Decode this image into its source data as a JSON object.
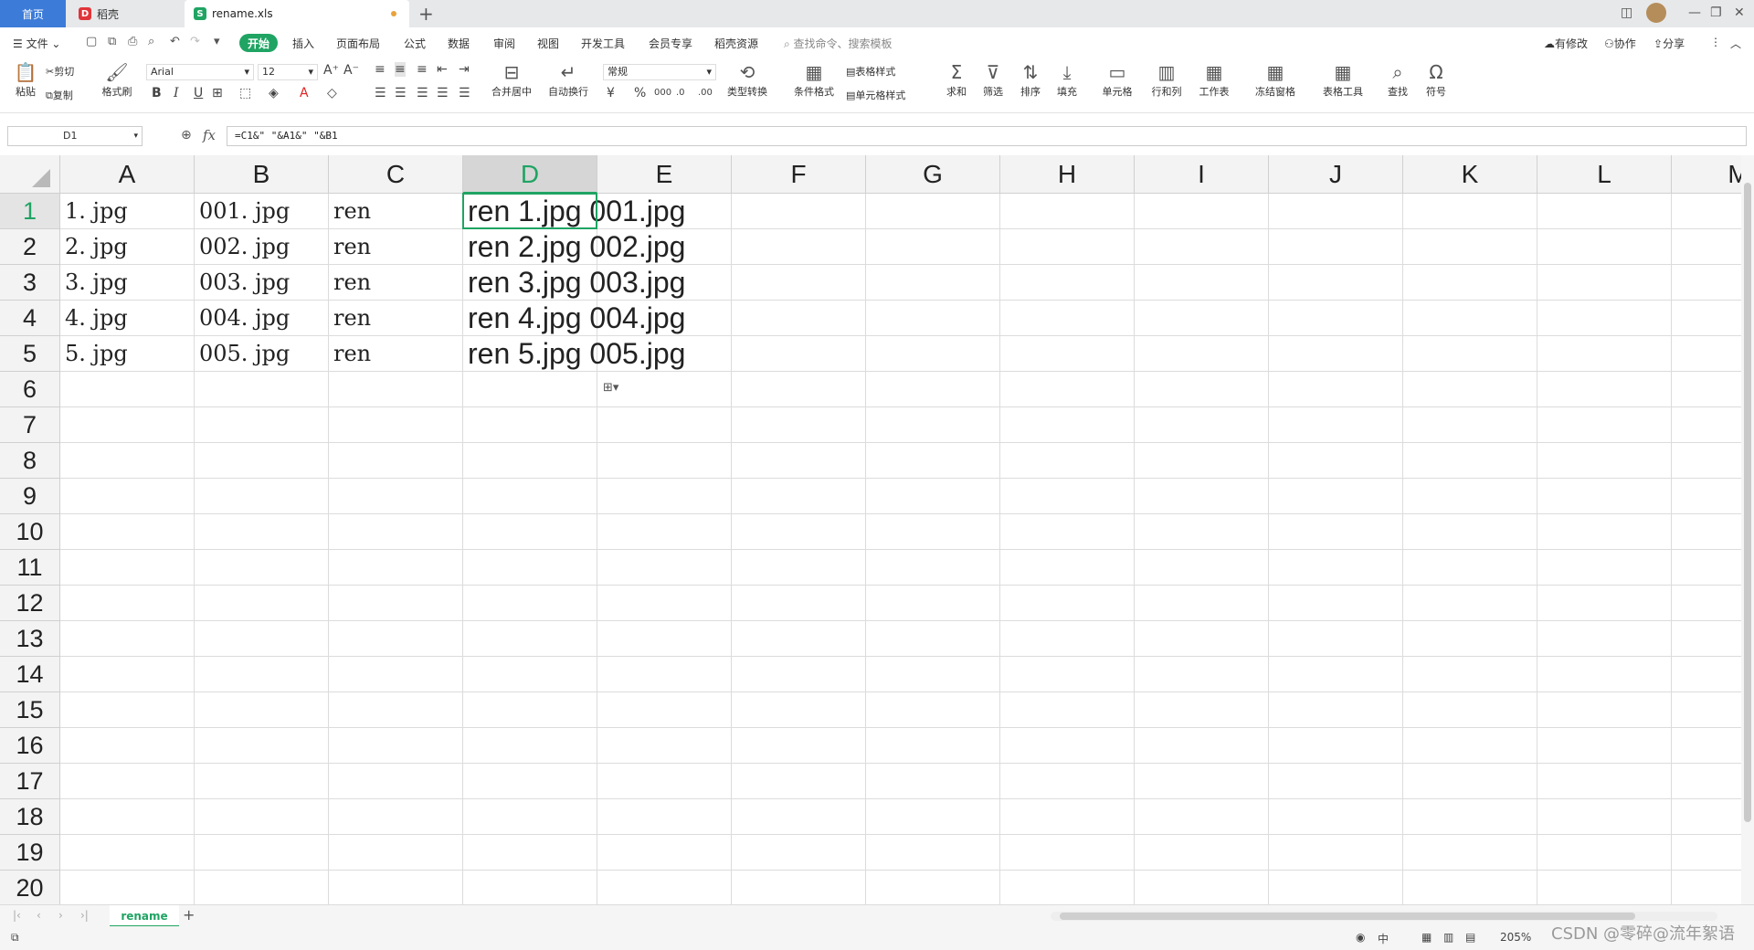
{
  "tabs": {
    "home": "首页",
    "daoke": "稻壳",
    "file": "rename.xls"
  },
  "menu": {
    "file": "文件",
    "start": "开始",
    "items": [
      "插入",
      "页面布局",
      "公式",
      "数据",
      "审阅",
      "视图",
      "开发工具",
      "会员专享",
      "稻壳资源"
    ],
    "search_placeholder": "查找命令、搜索模板",
    "modified": "有修改",
    "collaborate": "协作",
    "share": "分享"
  },
  "ribbon": {
    "paste": "粘贴",
    "cut": "剪切",
    "copy": "复制",
    "format_painter": "格式刷",
    "font_name": "Arial",
    "font_size": "12",
    "merge_center": "合并居中",
    "wrap_text": "自动换行",
    "number_format": "常规",
    "type_convert": "类型转换",
    "cond_format": "条件格式",
    "table_style": "表格样式",
    "cell_style": "单元格样式",
    "sum": "求和",
    "filter": "筛选",
    "sort": "排序",
    "fill": "填充",
    "cell": "单元格",
    "row_col": "行和列",
    "worksheet": "工作表",
    "freeze": "冻结窗格",
    "table_tools": "表格工具",
    "find": "查找",
    "symbol": "符号"
  },
  "formula_bar": {
    "name_box": "D1",
    "fx": "fx",
    "formula": "=C1&\" \"&A1&\" \"&B1"
  },
  "grid": {
    "columns": [
      "A",
      "B",
      "C",
      "D",
      "E",
      "F",
      "G",
      "H",
      "I",
      "J",
      "K",
      "L",
      "M"
    ],
    "rows": [
      "1",
      "2",
      "3",
      "4",
      "5",
      "6",
      "7",
      "8",
      "9",
      "10",
      "11",
      "12",
      "13",
      "14",
      "15",
      "16",
      "17",
      "18",
      "19",
      "20"
    ],
    "data": [
      [
        "1. jpg",
        "001. jpg",
        "ren",
        "ren 1.jpg 001.jpg"
      ],
      [
        "2. jpg",
        "002. jpg",
        "ren",
        "ren 2.jpg 002.jpg"
      ],
      [
        "3. jpg",
        "003. jpg",
        "ren",
        "ren 3.jpg 003.jpg"
      ],
      [
        "4. jpg",
        "004. jpg",
        "ren",
        "ren 4.jpg 004.jpg"
      ],
      [
        "5. jpg",
        "005. jpg",
        "ren",
        "ren 5.jpg 005.jpg"
      ]
    ],
    "selected_cell": "D1",
    "accent": "#1fa463"
  },
  "sheet_tabs": {
    "active": "rename"
  },
  "status": {
    "zoom": "205%"
  },
  "watermark": "CSDN @零碎@流年絮语"
}
